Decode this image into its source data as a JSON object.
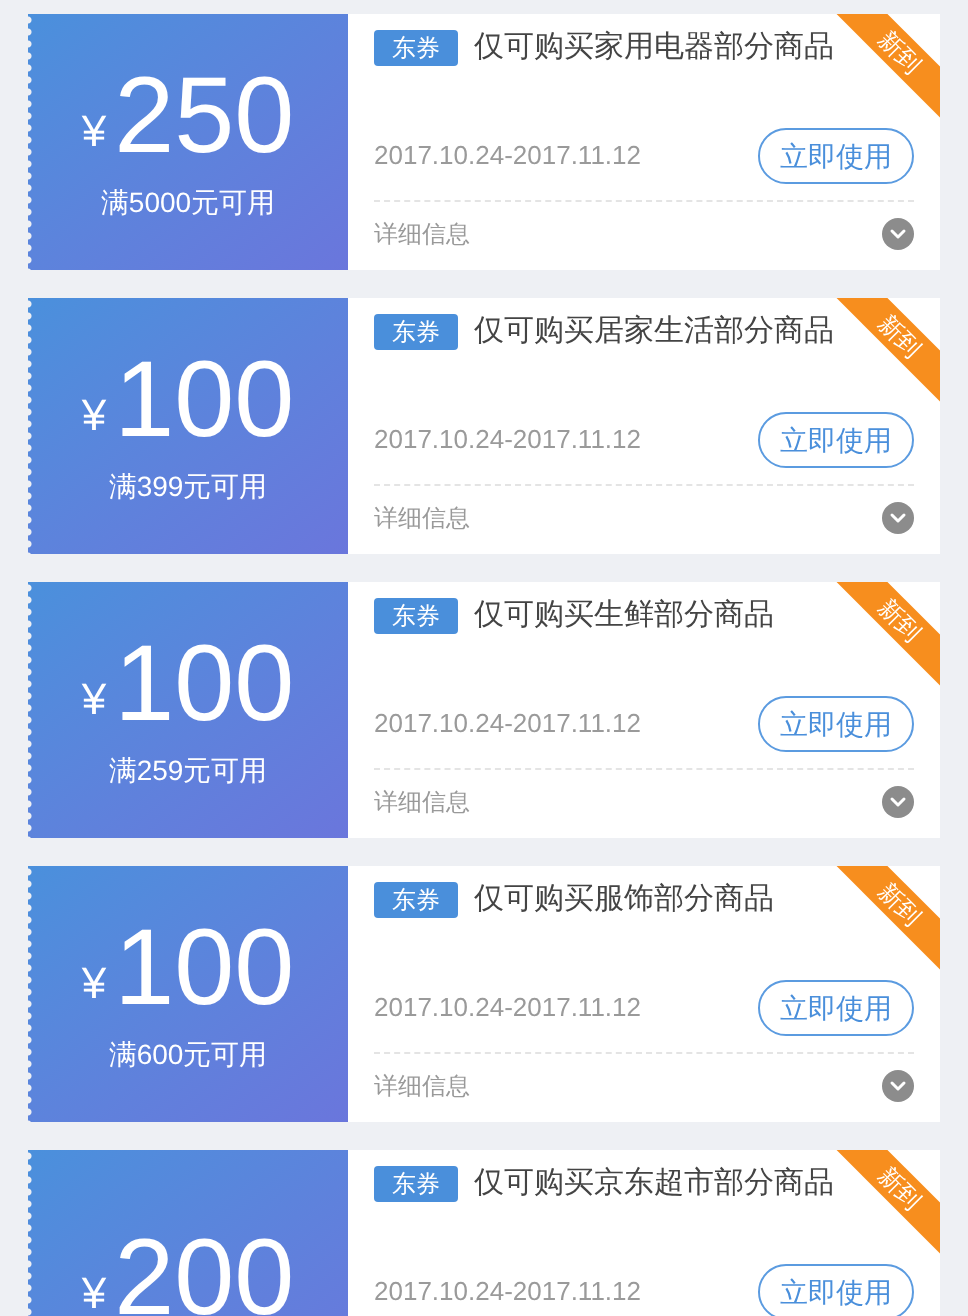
{
  "coupons": [
    {
      "currency": "¥",
      "amount": "250",
      "min": "满5000元可用",
      "tag": "东券",
      "title": "仅可购买家用电器部分商品",
      "ribbon": "新到",
      "date": "2017.10.24-2017.11.12",
      "button": "立即使用",
      "details": "详细信息"
    },
    {
      "currency": "¥",
      "amount": "100",
      "min": "满399元可用",
      "tag": "东券",
      "title": "仅可购买居家生活部分商品",
      "ribbon": "新到",
      "date": "2017.10.24-2017.11.12",
      "button": "立即使用",
      "details": "详细信息"
    },
    {
      "currency": "¥",
      "amount": "100",
      "min": "满259元可用",
      "tag": "东券",
      "title": "仅可购买生鲜部分商品",
      "ribbon": "新到",
      "date": "2017.10.24-2017.11.12",
      "button": "立即使用",
      "details": "详细信息"
    },
    {
      "currency": "¥",
      "amount": "100",
      "min": "满600元可用",
      "tag": "东券",
      "title": "仅可购买服饰部分商品",
      "ribbon": "新到",
      "date": "2017.10.24-2017.11.12",
      "button": "立即使用",
      "details": "详细信息"
    },
    {
      "currency": "¥",
      "amount": "200",
      "tag": "东券",
      "title": "仅可购买京东超市部分商品",
      "ribbon": "新到",
      "date": "2017.10.24-2017.11.12",
      "button": "立即使用"
    }
  ]
}
